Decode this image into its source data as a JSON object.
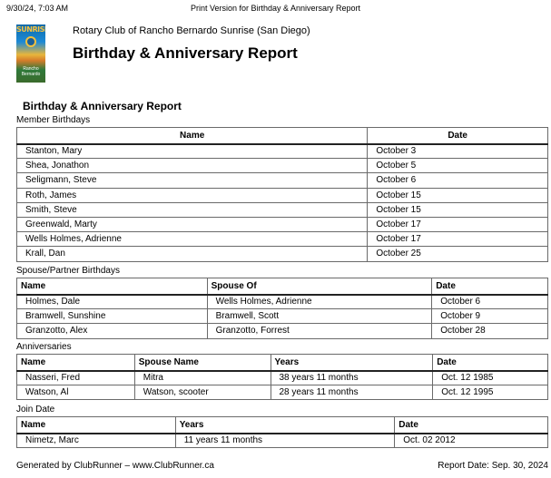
{
  "print_header": {
    "timestamp": "9/30/24, 7:03 AM",
    "title": "Print Version for Birthday & Anniversary Report"
  },
  "logo": {
    "top_text": "SUNRISE",
    "bottom_text": "Rancho Bernardo"
  },
  "club_name": "Rotary Club of Rancho Bernardo Sunrise (San Diego)",
  "report_title": "Birthday & Anniversary Report",
  "report_heading": "Birthday & Anniversary Report",
  "member_birthdays": {
    "label": "Member Birthdays",
    "headers": {
      "name": "Name",
      "date": "Date"
    },
    "rows": [
      {
        "name": "Stanton, Mary",
        "date": "October 3"
      },
      {
        "name": "Shea, Jonathon",
        "date": "October 5"
      },
      {
        "name": "Seligmann, Steve",
        "date": "October 6"
      },
      {
        "name": "Roth, James",
        "date": "October 15"
      },
      {
        "name": "Smith, Steve",
        "date": "October 15"
      },
      {
        "name": "Greenwald, Marty",
        "date": "October 17"
      },
      {
        "name": "Wells Holmes, Adrienne",
        "date": "October 17"
      },
      {
        "name": "Krall, Dan",
        "date": "October 25"
      }
    ]
  },
  "spouse_birthdays": {
    "label": "Spouse/Partner Birthdays",
    "headers": {
      "name": "Name",
      "spouse_of": "Spouse Of",
      "date": "Date"
    },
    "rows": [
      {
        "name": "Holmes, Dale",
        "spouse_of": "Wells Holmes, Adrienne",
        "date": "October 6"
      },
      {
        "name": "Bramwell, Sunshine",
        "spouse_of": "Bramwell, Scott",
        "date": "October 9"
      },
      {
        "name": "Granzotto, Alex",
        "spouse_of": "Granzotto, Forrest",
        "date": "October 28"
      }
    ]
  },
  "anniversaries": {
    "label": "Anniversaries",
    "headers": {
      "name": "Name",
      "spouse_name": "Spouse Name",
      "years": "Years",
      "date": "Date"
    },
    "rows": [
      {
        "name": "Nasseri, Fred",
        "spouse_name": "Mitra",
        "years": "38 years 11 months",
        "date": "Oct. 12 1985"
      },
      {
        "name": "Watson, Al",
        "spouse_name": "Watson, scooter",
        "years": "28 years 11 months",
        "date": "Oct. 12 1995"
      }
    ]
  },
  "join_date": {
    "label": "Join Date",
    "headers": {
      "name": "Name",
      "years": "Years",
      "date": "Date"
    },
    "rows": [
      {
        "name": "Nimetz, Marc",
        "years": "11 years 11 months",
        "date": "Oct. 02 2012"
      }
    ]
  },
  "footer": {
    "generated_by": "Generated by ClubRunner – www.ClubRunner.ca",
    "report_date": "Report Date: Sep. 30, 2024"
  }
}
